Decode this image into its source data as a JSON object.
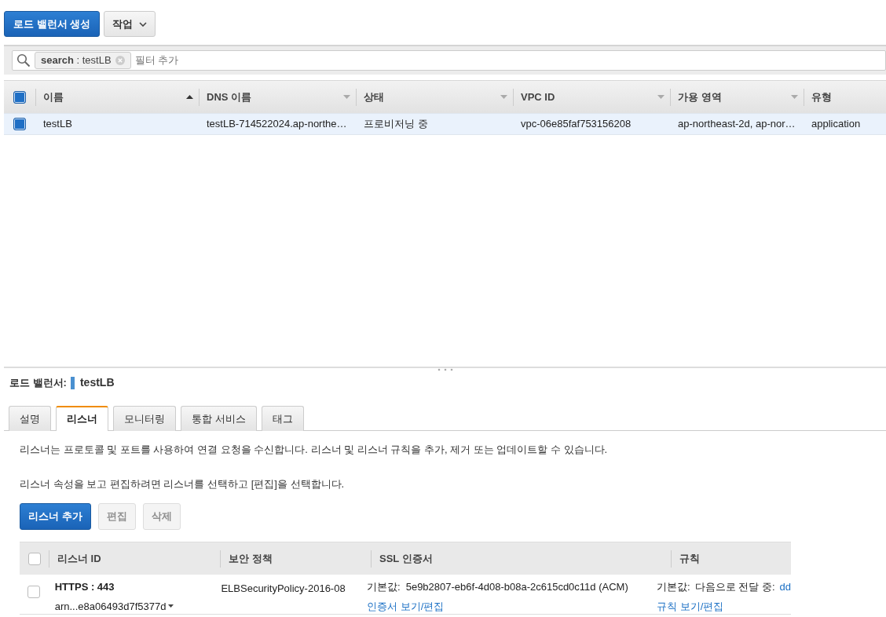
{
  "toolbar": {
    "create_button": "로드 밸런서 생성",
    "actions_button": "작업"
  },
  "filter": {
    "token": "**search** : testLB",
    "placeholder": "필터 추가"
  },
  "table": {
    "select_all_checked": true,
    "columns": [
      {
        "label": "이름",
        "sorted": true
      },
      {
        "label": "DNS 이름",
        "sorted": false
      },
      {
        "label": "상태",
        "sorted": false
      },
      {
        "label": "VPC ID",
        "sorted": false
      },
      {
        "label": "가용 영역",
        "sorted": false
      },
      {
        "label": "유형"
      }
    ],
    "rows": [
      {
        "selected": true,
        "cells": [
          "testLB",
          "testLB-714522024.ap-northe…",
          "프로비저닝 중",
          "vpc-06e85faf753156208",
          "ap-northeast-2d, ap-nor…",
          "application"
        ]
      }
    ]
  },
  "details": {
    "label": "로드 밸런서:",
    "name": "testLB",
    "tabs": [
      {
        "label": "설명",
        "selected": false
      },
      {
        "label": "리스너",
        "selected": true
      },
      {
        "label": "모니터링",
        "selected": false
      },
      {
        "label": "통합 서비스",
        "selected": false
      },
      {
        "label": "태그",
        "selected": false
      }
    ],
    "paragraphs": [
      "리스너는 프로토콜 및 포트를 사용하여 연결 요청을 수신합니다. 리스너 및 리스너 규칙을 추가, 제거 또는 업데이트할 수 있습니다.",
      "리스너 속성을 보고 편집하려면 리스너를 선택하고 [편집]을 선택합니다."
    ],
    "buttons": [
      {
        "label": "리스너 추가",
        "kind": "primary",
        "disabled": false
      },
      {
        "label": "편집",
        "kind": "secondary",
        "disabled": true
      },
      {
        "label": "삭제",
        "kind": "secondary",
        "disabled": true
      }
    ],
    "listeners": {
      "select_all_checked": false,
      "columns": [
        "리스너 ID",
        "보안 정책",
        "SSL 인증서",
        "규칙"
      ],
      "rows": [
        {
          "checked": false,
          "protocol": "HTTPS : 443",
          "arn": "arn...e8a06493d7f5377d",
          "policy": "ELBSecurityPolicy-2016-08",
          "cert_label": "기본값:",
          "cert_value": "5e9b2807-eb6f-4d08-b08a-2c615cd0c11d (ACM)",
          "cert_link": "인증서 보기/편집",
          "rule_label": "기본값:",
          "rule_text": "다음으로 전달 중:",
          "rule_target": "dd",
          "rule_link": "규칙 보기/편집"
        }
      ]
    }
  }
}
